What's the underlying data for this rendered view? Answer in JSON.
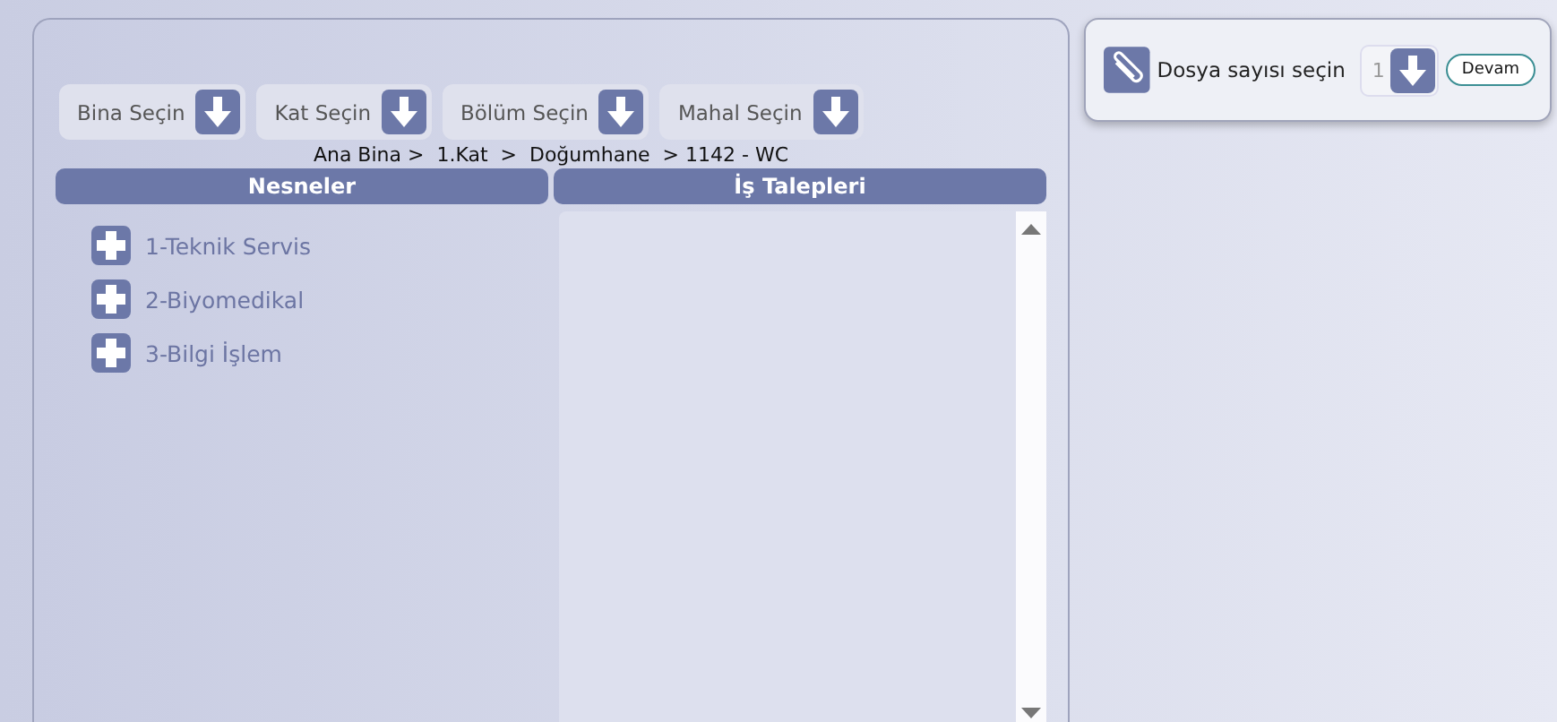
{
  "filters": [
    {
      "label": "Bina Seçin"
    },
    {
      "label": "Kat Seçin"
    },
    {
      "label": "Bölüm Seçin"
    },
    {
      "label": "Mahal Seçin"
    }
  ],
  "breadcrumb": "Ana Bina >  1.Kat  >  Doğumhane  > 1142 - WC",
  "columns": [
    "Nesneler",
    "İş Talepleri"
  ],
  "objects": [
    {
      "label": "1-Teknik Servis"
    },
    {
      "label": "2-Biyomedikal"
    },
    {
      "label": "3-Bilgi İşlem"
    }
  ],
  "file_panel": {
    "label": "Dosya sayısı seçin",
    "count": "1",
    "button": "Devam"
  }
}
